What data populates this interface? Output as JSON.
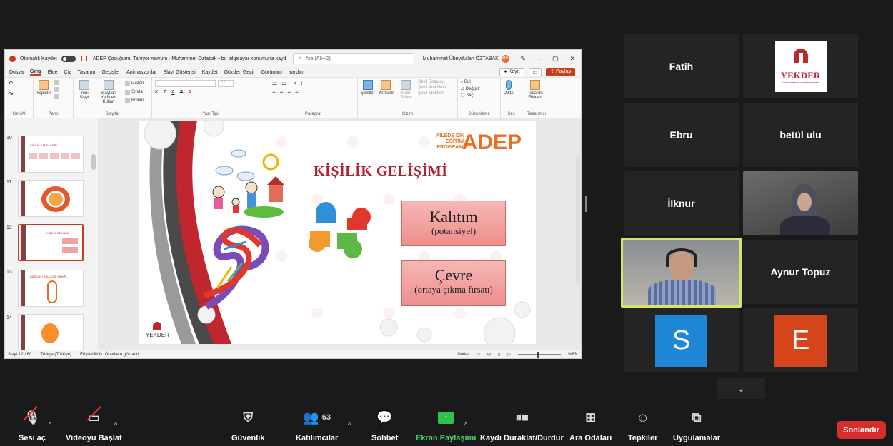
{
  "ppt": {
    "autosave_label": "Otomatik Kaydet",
    "doc_title": "ADEP Çocuğumu Tanıyor muyum - Muhammet Öztabak • bu bilgisayar konumuna kaydedildi",
    "search_placeholder": "Ara (Alt+G)",
    "user_name": "Muhammet Übeydullah ÖZTABAK",
    "user_initials": "MÖ",
    "tabs": [
      "Dosya",
      "Giriş",
      "Ekle",
      "Çiz",
      "Tasarım",
      "Geçişler",
      "Animasyonlar",
      "Slayt Gösterisi",
      "Kaydet",
      "Gözden Geçir",
      "Görünüm",
      "Yardım"
    ],
    "kayit_label": "Kayıt",
    "paylas_label": "Paylaş",
    "ribbon": {
      "geri_al": "Geri Al",
      "yapistir": "Yapıştır",
      "pano": "Pano",
      "yeni_slayt": "Yeni Slayt",
      "slaytlari_yeniden_kullan": "Slaytları Yeniden Kullan",
      "duzen": "Düzen",
      "sifirla": "Sıfırla",
      "bolum": "Bölüm",
      "slaytlar": "Slaytlar",
      "font_size": "22",
      "yazi_tipi": "Yazı Tipi",
      "paragraf": "Paragraf",
      "sekiller": "Şekiller",
      "yerlestir": "Yerleştir",
      "hizli_stiller": "Hızlı Stiller",
      "sekil_dolgusu": "Şekil Dolgusu",
      "sekil_ana_hatti": "Şekil Ana Hattı",
      "sekil_efektleri": "Şekil Efektleri",
      "cizim": "Çizim",
      "bul": "Bul",
      "degistir": "Değiştir",
      "sec": "Seç",
      "duzenleme": "Düzenleme",
      "dikte": "Dikte",
      "ses": "Ses",
      "tasarim_fikirleri": "Tasarım Fikirleri",
      "tasarimci": "Tasarımcı"
    },
    "slide_numbers": [
      "10",
      "11",
      "12",
      "13",
      "14"
    ],
    "thumb_titles": [
      "KİŞİLİK ETMENLERİ",
      "",
      "KİŞİLİK GELİŞİMİ",
      "SAĞLIKLI BELLEĞE SAHİP...",
      ""
    ],
    "slide": {
      "title": "KİŞİLİK GELİŞİMİ",
      "logo_text": "ADEP",
      "logo_sub": "AİLEDE DİN EĞİTİMİ PROGRAMI",
      "box1_main": "Kalıtım",
      "box1_sub": "(potansiyel)",
      "box2_main": "Çevre",
      "box2_sub": "(ortaya çıkma fırsatı)",
      "corner_logo": "YEKDER"
    },
    "status": {
      "slide_count": "Slayt 12 / 60",
      "language": "Türkçe (Türkiye)",
      "accessibility": "Erişilebilirlik: Önerilere göz atın",
      "notes": "Notlar",
      "zoom": "%63"
    }
  },
  "participants": [
    {
      "name": "Fatih"
    },
    {
      "name": "YEKDER",
      "logo_tag": "KADIN EĞİTİM VE KÜLTÜR DERNEĞİ"
    },
    {
      "name": "Ebru"
    },
    {
      "name": "betül ulu"
    },
    {
      "name": "İlknur"
    },
    {
      "name": "Aynur Topuz"
    },
    {
      "initial": "S",
      "color": "#1e88d6"
    },
    {
      "initial": "E",
      "color": "#d5451b"
    }
  ],
  "toolbar": {
    "mute": "Sesi aç",
    "video": "Videoyu Başlat",
    "security": "Güvenlik",
    "participants": "Katılımcılar",
    "participants_count": "63",
    "chat": "Sohbet",
    "share": "Ekran Paylaşımı",
    "record": "Kaydı Duraklat/Durdur",
    "breakout": "Ara Odaları",
    "reactions": "Tepkiler",
    "apps": "Uygulamalar",
    "end": "Sonlandır"
  }
}
